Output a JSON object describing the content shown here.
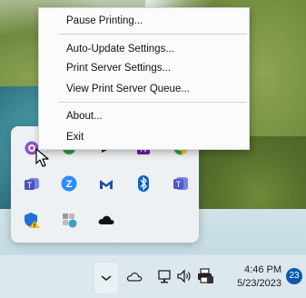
{
  "context_menu": {
    "items": [
      {
        "label": "Pause Printing..."
      },
      {
        "label": "Auto-Update Settings..."
      },
      {
        "label": "Print Server Settings..."
      },
      {
        "label": "View Print Server Queue..."
      },
      {
        "label": "About..."
      },
      {
        "label": "Exit"
      }
    ]
  },
  "tray_overflow": {
    "icons": [
      {
        "name": "print-app-icon",
        "color": "#8a55c9"
      },
      {
        "name": "green-app-icon",
        "color": "#2f9e44"
      },
      {
        "name": "arrow-app-icon",
        "color": "#222222"
      },
      {
        "name": "onenote-icon",
        "color": "#7719aa"
      },
      {
        "name": "chrome-icon",
        "color": "#2e9e44"
      },
      {
        "name": "teams-icon",
        "color": "#4b53bc"
      },
      {
        "name": "zoom-icon",
        "color": "#2d8cff"
      },
      {
        "name": "malwarebytes-icon",
        "color": "#1c4fa3"
      },
      {
        "name": "bluetooth-icon",
        "color": "#0a62c9"
      },
      {
        "name": "teams-business-icon",
        "color": "#5059c9"
      },
      {
        "name": "security-warning-icon",
        "color": "#1f6fd6"
      },
      {
        "name": "settings-app-icon",
        "color": "#3aa0c8"
      },
      {
        "name": "onedrive-icon",
        "color": "#111111"
      }
    ]
  },
  "taskbar": {
    "icons": [
      "chevron-up-icon",
      "onedrive-icon",
      "network-icon",
      "volume-icon",
      "printer-icon"
    ],
    "clock": {
      "time": "4:46 PM",
      "date": "5/23/2023"
    },
    "notification_count": "23"
  }
}
